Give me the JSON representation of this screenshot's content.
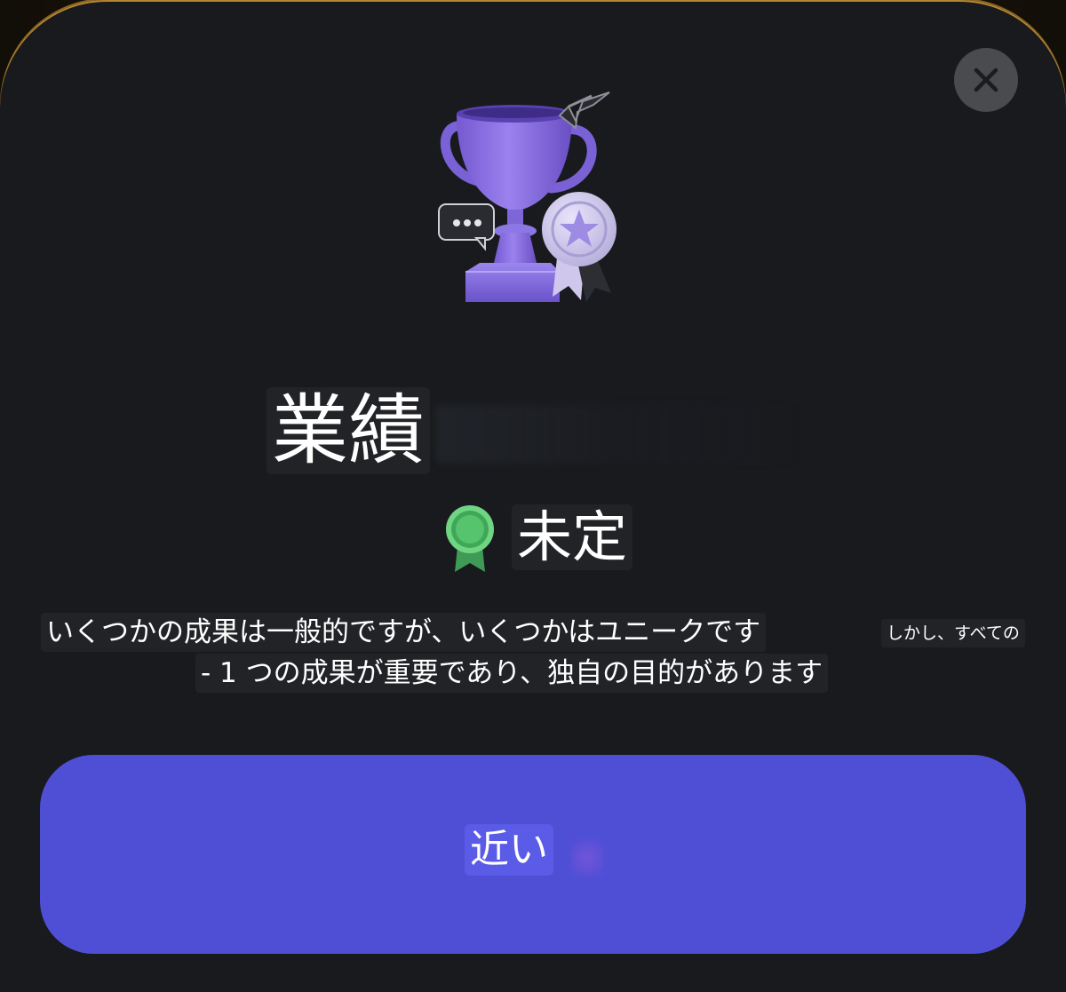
{
  "dialog": {
    "title": "業績",
    "status_label": "未定",
    "description_line1": "いくつかの成果は一般的ですが、いくつかはユニークです",
    "description_line1_tail": "しかし、すべての",
    "description_line2": "- 1 つの成果が重要であり、独自の目的があります",
    "close_button_label": "近い"
  },
  "icons": {
    "close": "close-icon",
    "trophy": "trophy-illustration",
    "status": "ribbon-badge-icon"
  },
  "colors": {
    "background": "#191a1e",
    "accent_button": "#4f4fd6",
    "status_badge": "#5bbf6a",
    "close_circle": "#4a4b4f",
    "trophy": "#8a6fe0",
    "rim": "#b4862f"
  }
}
